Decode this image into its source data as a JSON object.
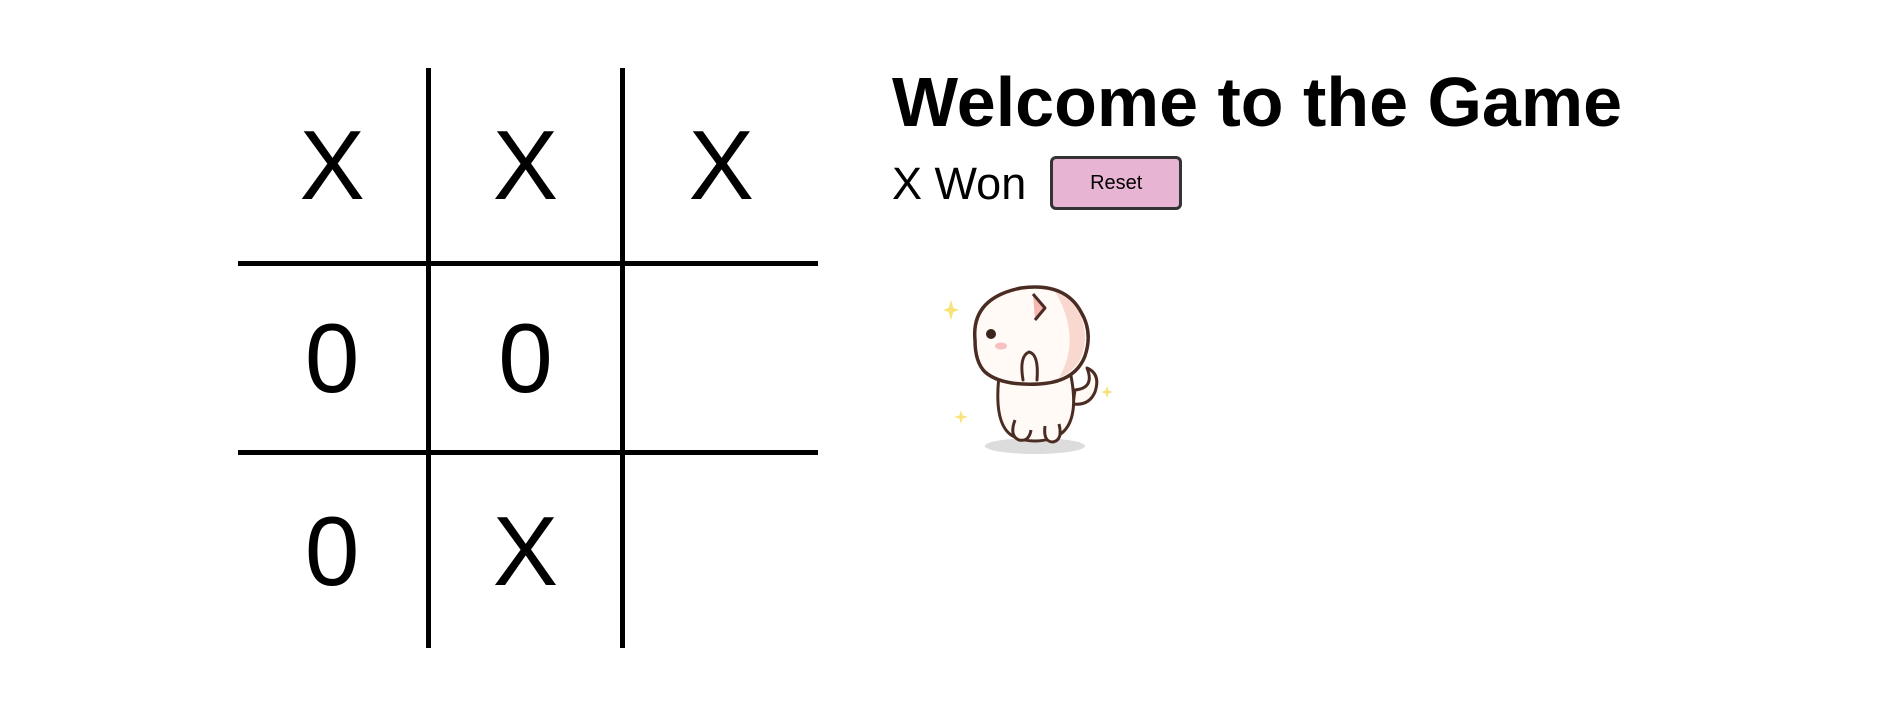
{
  "game": {
    "board": [
      "X",
      "X",
      "X",
      "0",
      "0",
      "",
      "0",
      "X",
      ""
    ]
  },
  "panel": {
    "title": "Welcome to the Game",
    "status": "X Won",
    "reset_label": "Reset"
  },
  "colors": {
    "reset_button_bg": "#e8b4d3",
    "grid_lines": "#000000",
    "sparkle": "#f7e37a"
  },
  "mascot": {
    "icon": "cat-mascot-icon"
  }
}
